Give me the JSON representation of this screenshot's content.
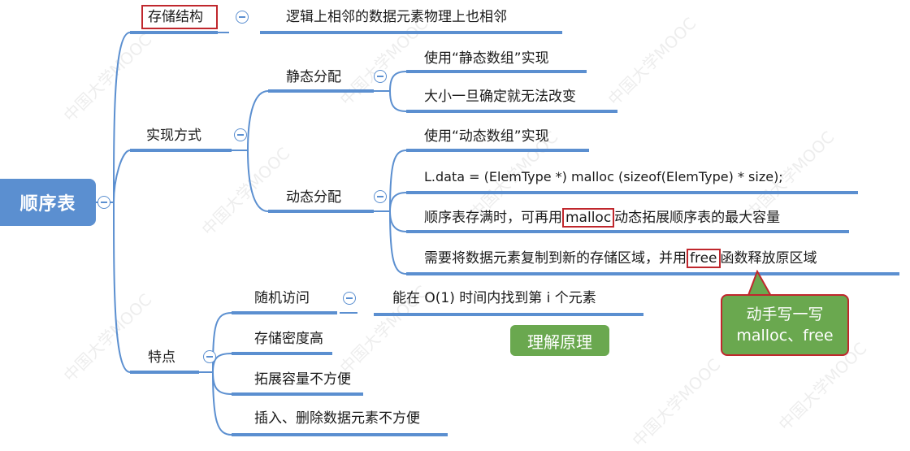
{
  "root": {
    "label": "顺序表"
  },
  "branches": {
    "storage": {
      "label": "存储结构",
      "desc": "逻辑上相邻的数据元素物理上也相邻"
    },
    "impl": {
      "label": "实现方式",
      "static": {
        "label": "静态分配",
        "items": [
          "使用“静态数组”实现",
          "大小一旦确定就无法改变"
        ]
      },
      "dynamic": {
        "label": "动态分配",
        "items": [
          "使用“动态数组”实现",
          "L.data = (ElemType *) malloc (sizeof(ElemType) * size);"
        ],
        "item3": {
          "pre": "顺序表存满时，可再用",
          "highlight": "malloc",
          "post": "动态拓展顺序表的最大容量"
        },
        "item4": {
          "pre": "需要将数据元素复制到新的存储区域，并用",
          "highlight": "free",
          "post": "函数释放原区域"
        }
      }
    },
    "features": {
      "label": "特点",
      "random": {
        "label": "随机访问",
        "desc": "能在 O(1) 时间内找到第 i 个元素"
      },
      "items": [
        "存储密度高",
        "拓展容量不方便",
        "插入、删除数据元素不方便"
      ]
    }
  },
  "callouts": {
    "understand": "理解原理",
    "handwrite_line1": "动手写一写",
    "handwrite_line2": "malloc、free"
  },
  "watermark": "中国大学MOOC",
  "colors": {
    "line": "#5b8fd0",
    "green": "#6aa84f",
    "red": "#c0272d"
  }
}
